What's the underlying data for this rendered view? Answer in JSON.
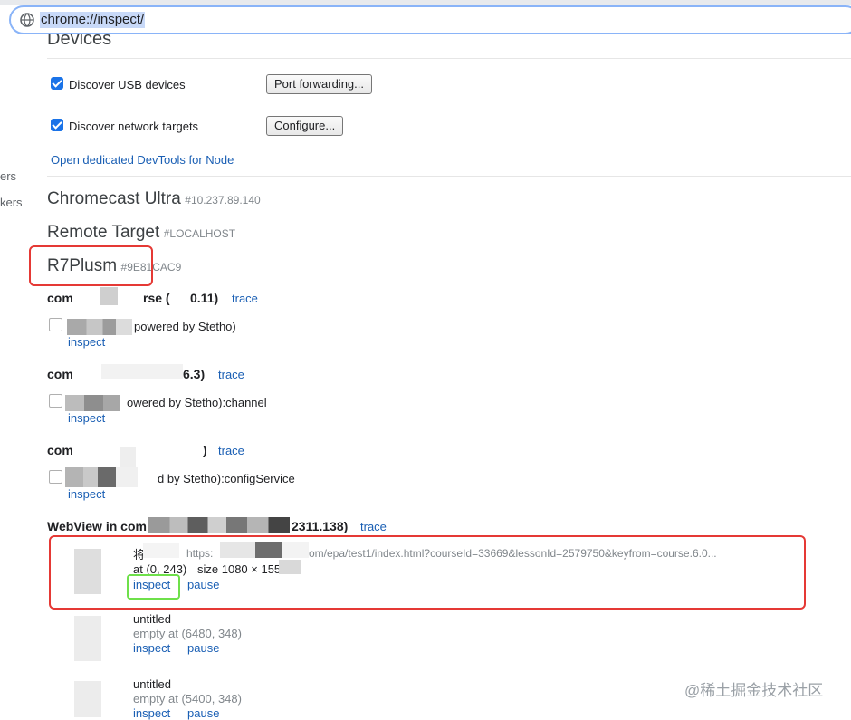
{
  "address_bar": {
    "url": "chrome://inspect/"
  },
  "left_cut": [
    "ers",
    "kers"
  ],
  "devices": {
    "title": "Devices",
    "discover_usb": {
      "label": "Discover USB devices",
      "checked": true,
      "button": "Port forwarding..."
    },
    "discover_network": {
      "label": "Discover network targets",
      "checked": true,
      "button": "Configure..."
    },
    "node_link": "Open dedicated DevTools for Node"
  },
  "remote_devices": [
    {
      "name": "Chromecast Ultra",
      "serial": "#10.237.89.140"
    },
    {
      "name": "Remote Target",
      "serial": "#LOCALHOST"
    },
    {
      "name": "R7Plusm",
      "serial": "#9E81CAC9"
    }
  ],
  "targets": [
    {
      "title_start": "com",
      "title_end": "rse (",
      "title_end2": "0.11)",
      "trace": "trace",
      "page_title": "powered by Stetho)",
      "action": "inspect"
    },
    {
      "title_start": "com",
      "title_end": "6.3)",
      "trace": "trace",
      "page_title": "owered by Stetho):channel",
      "action": "inspect"
    },
    {
      "title_start": "com",
      "title_end": ")",
      "trace": "trace",
      "page_title": "d by Stetho):configService",
      "action": "inspect"
    }
  ],
  "webview": {
    "title_start": "WebView in com",
    "title_end": "2311.138)",
    "trace": "trace",
    "pages": [
      {
        "title": "将",
        "url": "https:",
        "url_end": "om/epa/test1/index.html?courseId=33669&lessonId=2579750&keyfrom=course.6.0...",
        "pos": "at (0, 243)",
        "size": "size 1080 × 1557",
        "inspect": "inspect",
        "pause": "pause"
      },
      {
        "title": "untitled",
        "info": "empty  at (6480, 348)",
        "inspect": "inspect",
        "pause": "pause"
      },
      {
        "title": "untitled",
        "info": "empty  at (5400, 348)",
        "inspect": "inspect",
        "pause": "pause"
      }
    ]
  },
  "watermark": "@稀土掘金技术社区",
  "colors": {
    "link": "#1a5fb4",
    "checkbox": "#1a73e8",
    "highlight_red": "#e53935",
    "highlight_green": "#6ee04a"
  }
}
